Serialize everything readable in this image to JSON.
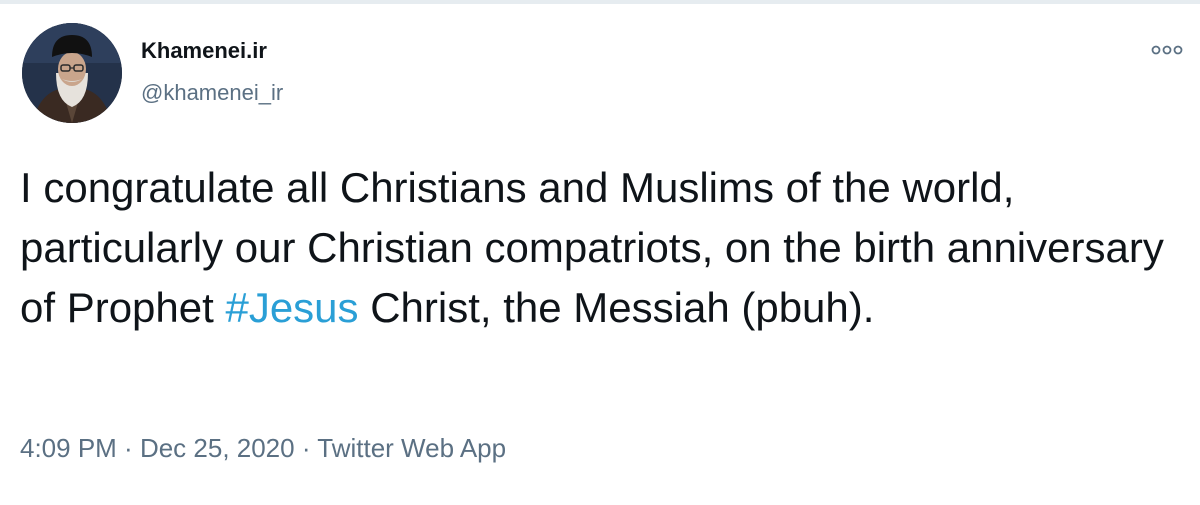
{
  "tweet": {
    "author": {
      "name": "Khamenei.ir",
      "handle": "@khamenei_ir",
      "avatar_icon": "avatar-portrait"
    },
    "more_icon": "more-options-icon",
    "text": {
      "part1": "I congratulate all Christians and Muslims of the world, particularly our Christian compatriots, on the birth anniversary of Prophet ",
      "hashtag": "#Jesus",
      "part2": " Christ, the Messiah (pbuh)."
    },
    "meta": {
      "time": "4:09 PM",
      "separator1": " · ",
      "date": "Dec 25, 2020",
      "separator2": " · ",
      "source": "Twitter Web App"
    }
  },
  "colors": {
    "name": "#0f1419",
    "secondary": "#5b7083",
    "hashtag": "#2a9fd6",
    "background": "#ffffff"
  }
}
